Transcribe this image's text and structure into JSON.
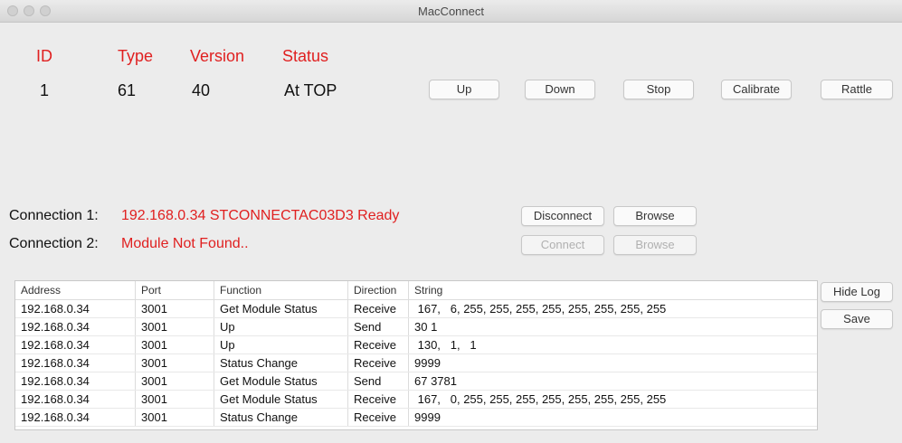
{
  "window": {
    "title": "MacConnect"
  },
  "device": {
    "headers": {
      "id": "ID",
      "type": "Type",
      "version": "Version",
      "status": "Status"
    },
    "values": {
      "id": "1",
      "type": "61",
      "version": "40",
      "status": "At TOP"
    }
  },
  "controls": {
    "up": "Up",
    "down": "Down",
    "stop": "Stop",
    "calibrate": "Calibrate",
    "rattle": "Rattle"
  },
  "connections": [
    {
      "label": "Connection 1:",
      "status": "192.168.0.34 STCONNECTAC03D3 Ready",
      "primary": "Disconnect",
      "browse": "Browse"
    },
    {
      "label": "Connection 2:",
      "status": "Module Not Found..",
      "primary": "Connect",
      "browse": "Browse"
    }
  ],
  "log": {
    "columns": [
      "Address",
      "Port",
      "Function",
      "Direction",
      "String"
    ],
    "rows": [
      [
        "192.168.0.34",
        "3001",
        "Get Module Status",
        "Receive",
        " 167,   6, 255, 255, 255, 255, 255, 255, 255, 255"
      ],
      [
        "192.168.0.34",
        "3001",
        "Up",
        "Send",
        "30 1"
      ],
      [
        "192.168.0.34",
        "3001",
        "Up",
        "Receive",
        " 130,   1,   1"
      ],
      [
        "192.168.0.34",
        "3001",
        "Status Change",
        "Receive",
        "9999"
      ],
      [
        "192.168.0.34",
        "3001",
        "Get Module Status",
        "Send",
        "67 3781"
      ],
      [
        "192.168.0.34",
        "3001",
        "Get Module Status",
        "Receive",
        " 167,   0, 255, 255, 255, 255, 255, 255, 255, 255"
      ],
      [
        "192.168.0.34",
        "3001",
        "Status Change",
        "Receive",
        "9999"
      ]
    ],
    "hide_log": "Hide Log",
    "save": "Save"
  }
}
